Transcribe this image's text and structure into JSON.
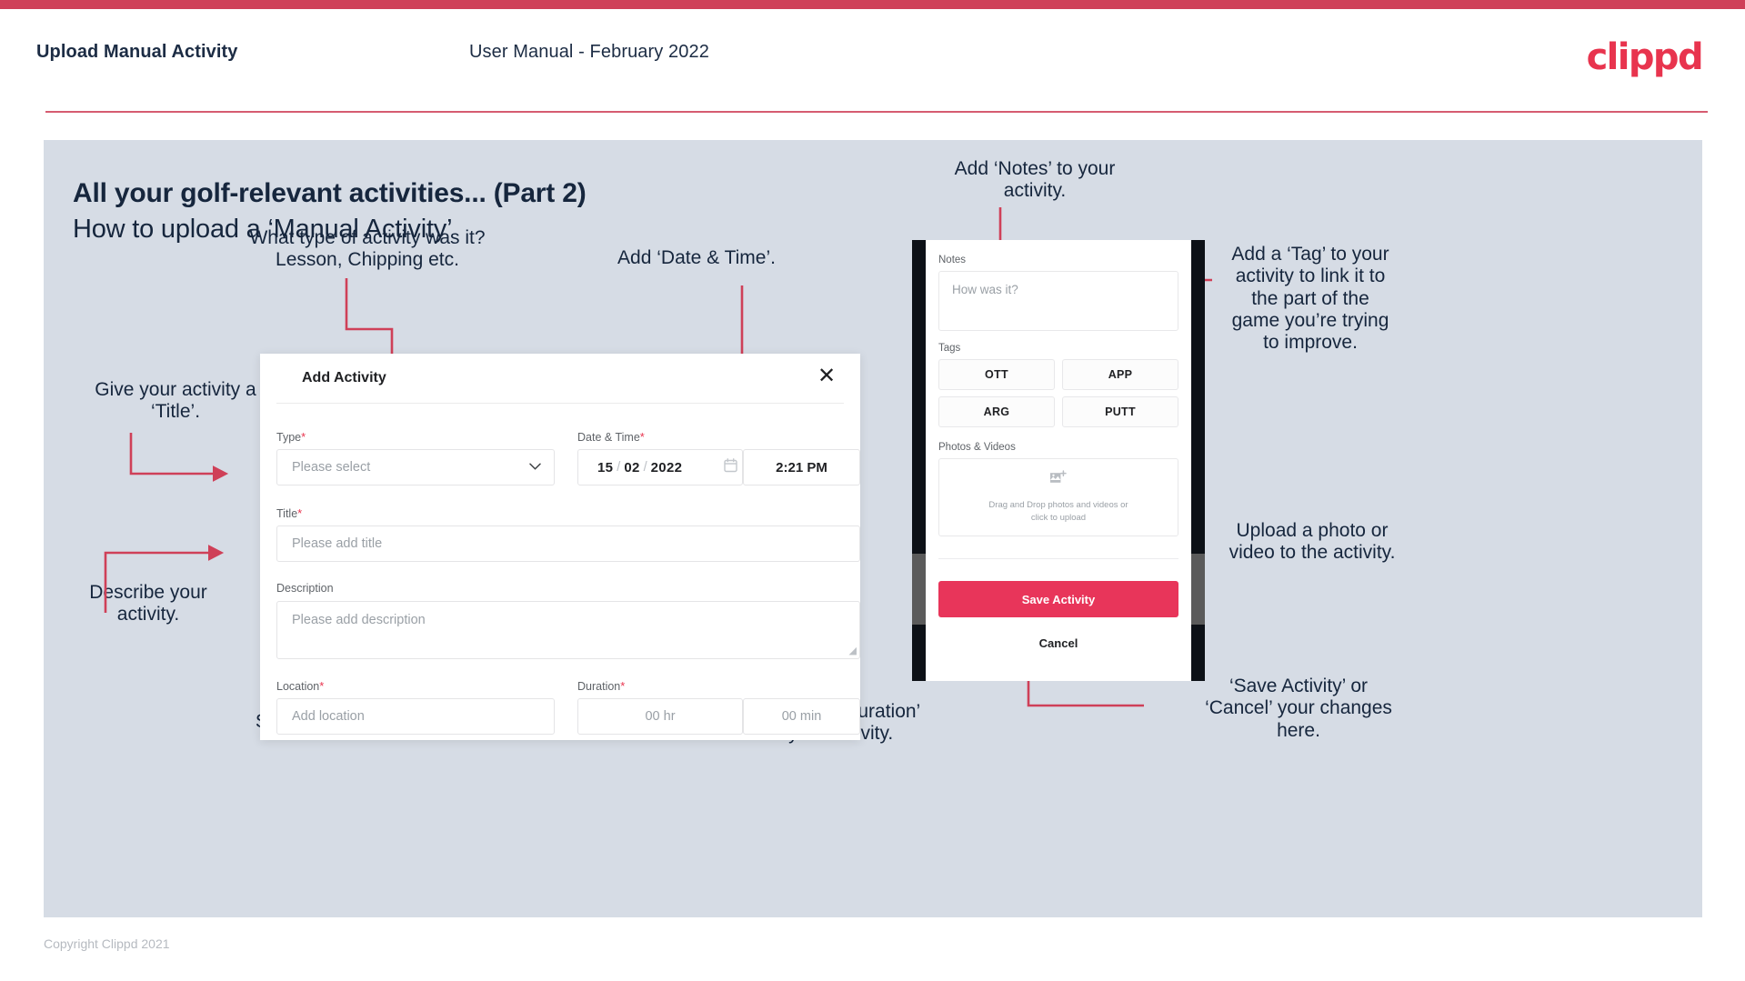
{
  "header": {
    "title": "Upload Manual Activity",
    "subtitle": "User Manual - February 2022",
    "logo": "clippd"
  },
  "slide": {
    "title": "All your golf-relevant activities... (Part 2)",
    "subtitle": "How to upload a ‘Manual Activity’"
  },
  "annotations": {
    "type": "What type of activity was it?\nLesson, Chipping etc.",
    "datetime": "Add ‘Date & Time’.",
    "title": "Give your activity a\n‘Title’.",
    "description": "Describe your\nactivity.",
    "location": "Specify the ‘Location’.",
    "duration": "Specify the ‘Duration’\nof your activity.",
    "notes": "Add ‘Notes’ to your\nactivity.",
    "tags": "Add a ‘Tag’ to your\nactivity to link it to\nthe part of the\ngame you’re trying\nto improve.",
    "photos": "Upload a photo or\nvideo to the activity.",
    "save": "‘Save Activity’ or\n‘Cancel’ your changes\nhere."
  },
  "dialog": {
    "title": "Add Activity",
    "close_icon": "close-icon",
    "fields": {
      "type": {
        "label": "Type",
        "required": "*",
        "placeholder": "Please select"
      },
      "datetime": {
        "label": "Date & Time",
        "required": "*",
        "day": "15",
        "month": "02",
        "year": "2022",
        "sep": "/",
        "time": "2:21 PM"
      },
      "title": {
        "label": "Title",
        "required": "*",
        "placeholder": "Please add title"
      },
      "description": {
        "label": "Description",
        "placeholder": "Please add description"
      },
      "location": {
        "label": "Location",
        "required": "*",
        "placeholder": "Add location"
      },
      "duration": {
        "label": "Duration",
        "required": "*",
        "hours_placeholder": "00 hr",
        "minutes_placeholder": "00 min"
      }
    }
  },
  "phone": {
    "notes": {
      "label": "Notes",
      "placeholder": "How was it?"
    },
    "tags": {
      "label": "Tags",
      "items": [
        "OTT",
        "APP",
        "ARG",
        "PUTT"
      ]
    },
    "photos": {
      "label": "Photos & Videos",
      "dropzone_text": "Drag and Drop photos and videos or\nclick to upload",
      "icon": "add-image-icon"
    },
    "save_label": "Save Activity",
    "cancel_label": "Cancel"
  },
  "footer": {
    "copyright": "Copyright Clippd 2021"
  },
  "colors": {
    "brand_red": "#e8344e",
    "accent_pink": "#cf4058",
    "slide_bg": "#d6dce5",
    "text_dark": "#16263d",
    "save_button": "#e8355a"
  }
}
